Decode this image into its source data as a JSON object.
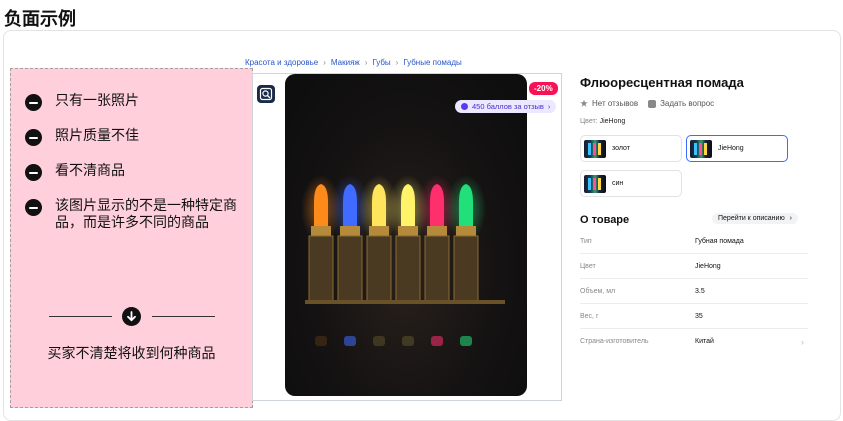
{
  "page_title": "负面示例",
  "note": {
    "items": [
      "只有一张照片",
      "照片质量不佳",
      "看不清商品",
      "该图片显示的不是一种特定商品，而是许多不同的商品"
    ],
    "summary": "买家不清楚将收到何种商品"
  },
  "breadcrumb": [
    "Красота и здоровье",
    "Макияж",
    "Губы",
    "Губные помады"
  ],
  "product": {
    "discount": "-20%",
    "points": "450 баллов за отзыв",
    "title": "Флюоресцентная помада",
    "reviews": "Нет отзывов",
    "ask": "Задать вопрос",
    "color_label": "Цвет:",
    "color_value": "JieHong",
    "swatches": [
      "золот",
      "JieHong",
      "син"
    ],
    "lipstick_colors": [
      "#ff8a1c",
      "#3f6bff",
      "#ffe55c",
      "#fff36a",
      "#ff2f6e",
      "#21e07a"
    ]
  },
  "about": {
    "title": "О товаре",
    "link": "Перейти к описанию",
    "specs": [
      {
        "k": "Тип",
        "v": "Губная помада"
      },
      {
        "k": "Цвет",
        "v": "JieHong"
      },
      {
        "k": "Объем, мл",
        "v": "3.5"
      },
      {
        "k": "Вес, г",
        "v": "35"
      },
      {
        "k": "Страна-изготовитель",
        "v": "Китай"
      }
    ]
  }
}
